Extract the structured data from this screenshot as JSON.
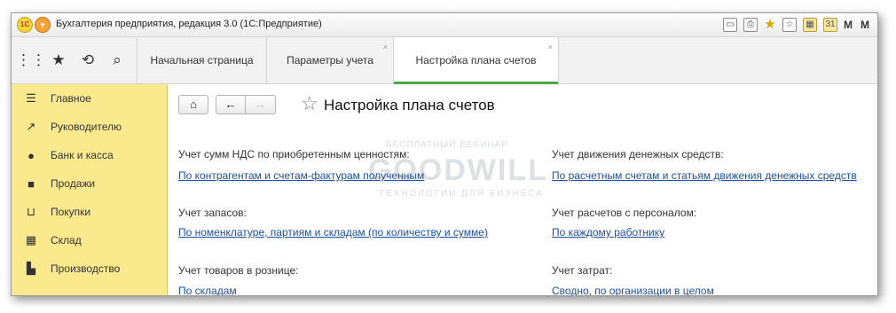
{
  "app": {
    "title": "Бухгалтерия предприятия, редакция 3.0  (1С:Предприятие)",
    "logo": "1С",
    "right_letters": [
      "M",
      "M"
    ]
  },
  "tabs": [
    {
      "label": "Начальная страница",
      "closable": false,
      "active": false
    },
    {
      "label": "Параметры учета",
      "closable": true,
      "active": false
    },
    {
      "label": "Настройка плана счетов",
      "closable": true,
      "active": true
    }
  ],
  "sidebar": {
    "items": [
      {
        "label": "Главное",
        "icon": "menu-lines-icon"
      },
      {
        "label": "Руководителю",
        "icon": "trend-icon"
      },
      {
        "label": "Банк и касса",
        "icon": "ruble-coin-icon"
      },
      {
        "label": "Продажи",
        "icon": "shopping-bag-icon"
      },
      {
        "label": "Покупки",
        "icon": "cart-icon"
      },
      {
        "label": "Склад",
        "icon": "warehouse-icon"
      },
      {
        "label": "Производство",
        "icon": "factory-icon"
      }
    ]
  },
  "page": {
    "title": "Настройка плана счетов",
    "left": [
      {
        "label": "Учет сумм НДС по приобретенным ценностям:",
        "value": "По контрагентам и счетам-фактурам полученным"
      },
      {
        "label": "Учет запасов:",
        "value": "По номенклатуре, партиям и складам (по количеству и сумме)"
      },
      {
        "label": "Учет товаров в рознице:",
        "value": "По складам"
      }
    ],
    "right": [
      {
        "label": "Учет движения денежных средств:",
        "value": "По расчетным счетам и статьям движения денежных средств"
      },
      {
        "label": "Учет расчетов с персоналом:",
        "value": "По каждому работнику"
      },
      {
        "label": "Учет затрат:",
        "value": "Сводно, по организации в целом"
      }
    ]
  },
  "watermark": {
    "top": "БЕСПЛАТНЫЙ ВЕБИНАР",
    "main": "GOODWILL",
    "sub": "ТЕХНОЛОГИИ ДЛЯ БИЗНЕСА"
  },
  "colors": {
    "sidebar_bg": "#fbe98e",
    "link": "#1c4fa6",
    "active_tab_underline": "#4aa84a"
  }
}
